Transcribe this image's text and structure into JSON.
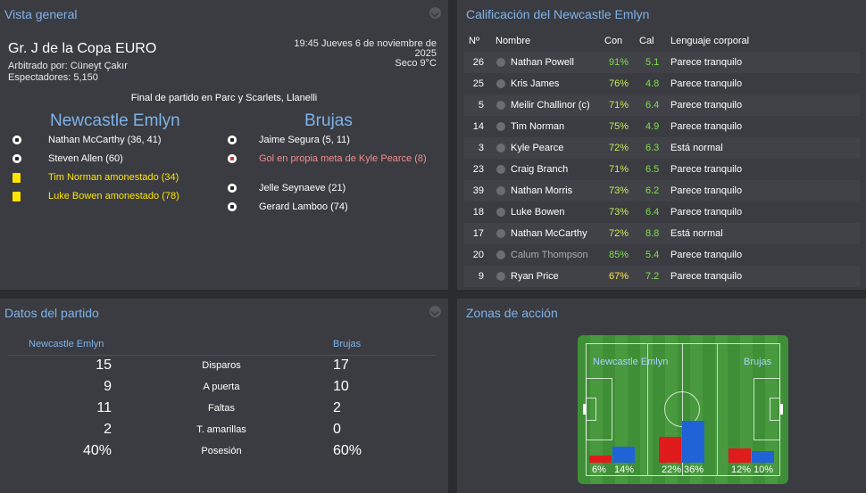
{
  "overview": {
    "title": "Vista general",
    "competition": "Gr. J de la Copa EURO",
    "referee": "Arbitrado por: Cüneyt Çakır",
    "attendance": "Espectadores: 5,150",
    "datetime": "19:45 Jueves 6 de noviembre de 2025",
    "weather": "Seco 9°C",
    "result_text": "Final de partido en Parc y Scarlets, Llanelli",
    "home_team": "Newcastle Emlyn",
    "away_team": "Brujas",
    "home_events": [
      {
        "icon": "goal-ball-icon",
        "text": "Nathan McCarthy (36, 41)"
      },
      {
        "icon": "goal-ball-icon",
        "text": "Steven Allen (60)"
      },
      {
        "icon": "yellow-card-icon",
        "text": "Tim Norman amonestado (34)"
      },
      {
        "icon": "yellow-card-icon",
        "text": "Luke Bowen amonestado (78)"
      }
    ],
    "away_events": [
      {
        "icon": "goal-ball-icon",
        "text": "Jaime Segura (5, 11)"
      },
      {
        "icon": "own-goal-ball-icon",
        "text": "Gol en propia meta de Kyle Pearce (8)"
      },
      {
        "icon": "goal-ball-icon",
        "text": "Jelle Seynaeve (21)"
      },
      {
        "icon": "goal-ball-icon",
        "text": "Gerard Lamboo (74)"
      }
    ]
  },
  "ratings": {
    "title": "Calificación del Newcastle Emlyn",
    "headers": {
      "num": "Nº",
      "name": "Nombre",
      "con": "Con",
      "cal": "Cal",
      "body": "Lenguaje corporal"
    },
    "rows": [
      {
        "num": "26",
        "name": "Nathan Powell",
        "con": "91%",
        "cal": "5.1",
        "body": "Parece tranquilo"
      },
      {
        "num": "25",
        "name": "Kris James",
        "con": "76%",
        "cal": "4.8",
        "body": "Parece tranquilo"
      },
      {
        "num": "5",
        "name": "Meilir Challinor (c)",
        "con": "71%",
        "cal": "6.4",
        "body": "Parece tranquilo"
      },
      {
        "num": "14",
        "name": "Tim Norman",
        "con": "75%",
        "cal": "4.9",
        "body": "Parece tranquilo"
      },
      {
        "num": "3",
        "name": "Kyle Pearce",
        "con": "72%",
        "cal": "6.3",
        "body": "Está normal"
      },
      {
        "num": "23",
        "name": "Craig Branch",
        "con": "71%",
        "cal": "6.5",
        "body": "Parece tranquilo"
      },
      {
        "num": "39",
        "name": "Nathan Morris",
        "con": "73%",
        "cal": "6.2",
        "body": "Parece tranquilo"
      },
      {
        "num": "18",
        "name": "Luke Bowen",
        "con": "73%",
        "cal": "6.4",
        "body": "Parece tranquilo"
      },
      {
        "num": "17",
        "name": "Nathan McCarthy",
        "con": "72%",
        "cal": "8.8",
        "body": "Está normal"
      },
      {
        "num": "20",
        "name": "Calum Thompson",
        "con": "85%",
        "cal": "5.4",
        "body": "Parece tranquilo"
      },
      {
        "num": "9",
        "name": "Ryan Price",
        "con": "67%",
        "cal": "7.2",
        "body": "Parece tranquilo"
      }
    ]
  },
  "stats": {
    "title": "Datos del partido",
    "home_team": "Newcastle Emlyn",
    "away_team": "Brujas",
    "rows": [
      {
        "home": "15",
        "label": "Disparos",
        "away": "17"
      },
      {
        "home": "9",
        "label": "A puerta",
        "away": "10"
      },
      {
        "home": "11",
        "label": "Faltas",
        "away": "2"
      },
      {
        "home": "2",
        "label": "T. amarillas",
        "away": "0"
      },
      {
        "home": "40%",
        "label": "Posesión",
        "away": "60%"
      }
    ]
  },
  "zones": {
    "title": "Zonas de acción",
    "home_team": "Newcastle Emlyn",
    "away_team": "Brujas",
    "home_color": "#e01b1b",
    "away_color": "#1f63d6",
    "zones": [
      {
        "home": 6,
        "away": 14,
        "home_label": "6%",
        "away_label": "14%"
      },
      {
        "home": 22,
        "away": 36,
        "home_label": "22%",
        "away_label": "36%"
      },
      {
        "home": 12,
        "away": 10,
        "home_label": "12%",
        "away_label": "10%"
      }
    ]
  }
}
